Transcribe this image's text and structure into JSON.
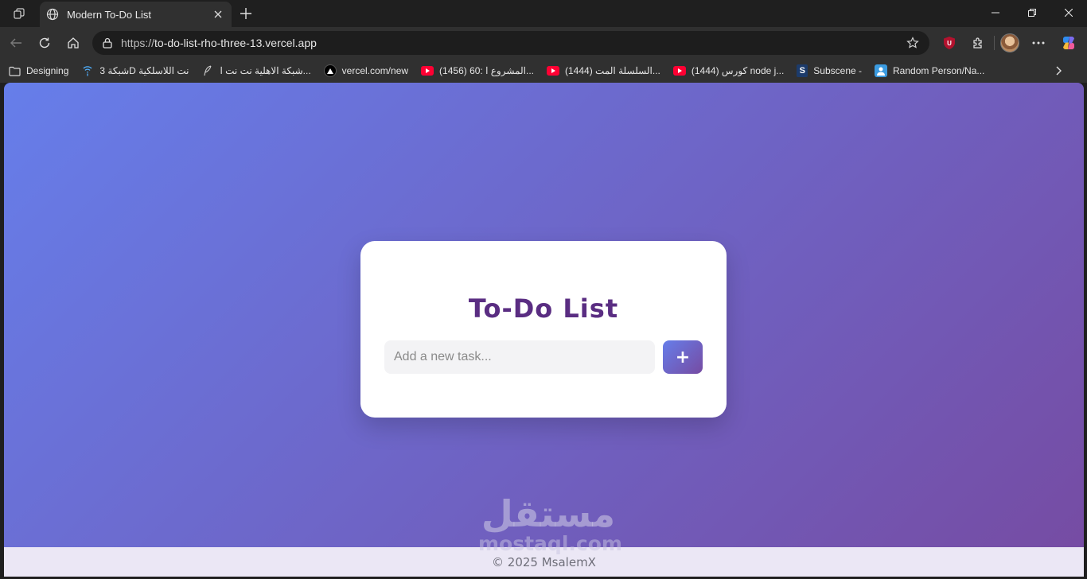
{
  "browser": {
    "tab": {
      "title": "Modern To-Do List"
    },
    "address_bar": {
      "protocol": "https://",
      "host": "to-do-list-rho-three-13.vercel.app"
    },
    "bookmarks": [
      {
        "label": "Designing",
        "icon": "folder-icon"
      },
      {
        "label": "شبكة 3D نت اللاسلكية",
        "icon": "wifi-icon"
      },
      {
        "label": "شبكة الاهلية نت نت ا...",
        "icon": "feather-icon"
      },
      {
        "label": "vercel.com/new",
        "icon": "vercel-icon"
      },
      {
        "label": "(1456) 60: المشروع ا...",
        "icon": "youtube-icon"
      },
      {
        "label": "(1444) السلسلة المت...",
        "icon": "youtube-icon"
      },
      {
        "label": "(1444) كورس node j...",
        "icon": "youtube-icon"
      },
      {
        "label": "Subscene -",
        "icon": "subscene-icon"
      },
      {
        "label": "Random Person/Na...",
        "icon": "person-icon"
      }
    ]
  },
  "app": {
    "title": "To-Do List",
    "input": {
      "placeholder": "Add a new task...",
      "value": ""
    },
    "add_button_label": "+",
    "footer": "© 2025 MsalemX"
  },
  "watermark": {
    "arabic": "مستقل",
    "latin": "mostaql.com"
  },
  "colors": {
    "gradient_start": "#667eea",
    "gradient_end": "#764ba2",
    "title_color": "#5a2d82"
  }
}
